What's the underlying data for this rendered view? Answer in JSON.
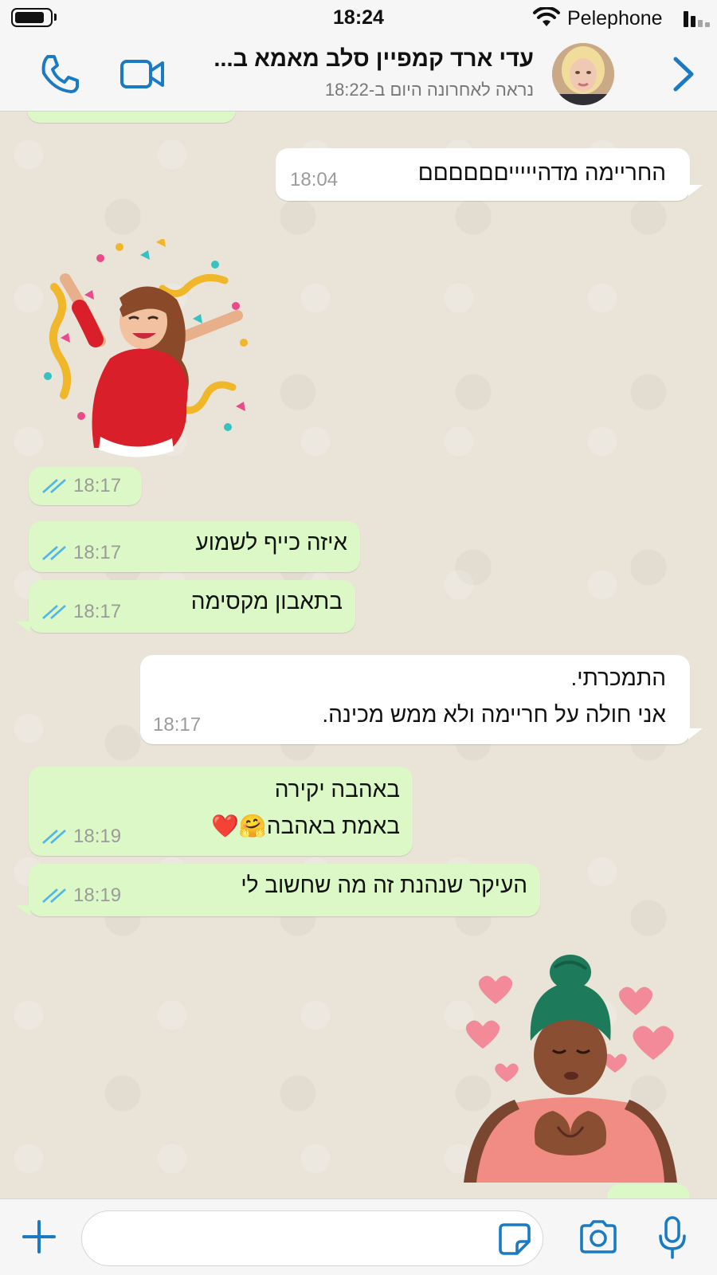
{
  "status_bar": {
    "time": "18:24",
    "carrier": "Pelephone"
  },
  "header": {
    "contact_name": "עדי ארד קמפיין סלב מאמא ב...",
    "last_seen": "נראה לאחרונה היום ב-18:22"
  },
  "messages": [
    {
      "dir": "in",
      "text": "החריימה מדהיייייםםםםםם",
      "time": "18:04"
    },
    {
      "dir": "out",
      "type": "sticker",
      "sticker": "woman-celebrating-confetti",
      "time": "18:17"
    },
    {
      "dir": "out",
      "text": "איזה כייף לשמוע",
      "time": "18:17"
    },
    {
      "dir": "out",
      "text": "בתאבון מקסימה",
      "time": "18:17"
    },
    {
      "dir": "in",
      "text_line1": "התמכרתי.",
      "text_line2": "אני חולה על חריימה ולא ממש מכינה.",
      "time": "18:17"
    },
    {
      "dir": "out",
      "text_line1": "באהבה יקירה",
      "text_line2": "באמת באהבה🤗❤️",
      "time": "18:19"
    },
    {
      "dir": "out",
      "text": "העיקר שנהנת זה מה שחשוב לי",
      "time": "18:19"
    },
    {
      "dir": "in",
      "type": "sticker",
      "sticker": "woman-heart-hands"
    }
  ],
  "input": {
    "placeholder": ""
  },
  "colors": {
    "accent": "#1a7bc4",
    "outgoing_bubble": "#dcf8c6",
    "incoming_bubble": "#ffffff",
    "read_ticks": "#4fb6ec",
    "chat_background": "#e9e3d8"
  }
}
